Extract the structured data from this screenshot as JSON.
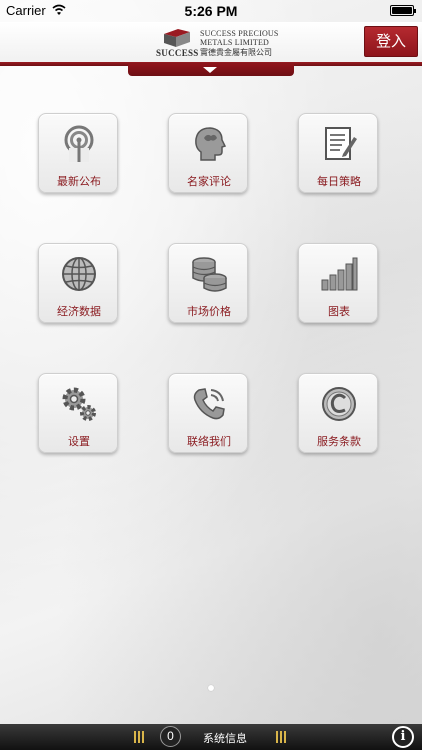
{
  "status_bar": {
    "carrier": "Carrier",
    "time": "5:26 PM"
  },
  "header": {
    "logo": {
      "brand": "SUCCESS",
      "line1": "SUCCESS PRECIOUS",
      "line2": "METALS LIMITED",
      "line3": "實德貴金屬有限公司"
    },
    "login_label": "登入",
    "accent_color": "#8e141b"
  },
  "grid": {
    "items": [
      {
        "label": "最新公布",
        "icon": "broadcast-icon"
      },
      {
        "label": "名家评论",
        "icon": "head-profile-icon"
      },
      {
        "label": "每日策略",
        "icon": "document-pen-icon"
      },
      {
        "label": "经济数据",
        "icon": "globe-icon"
      },
      {
        "label": "市场价格",
        "icon": "coins-stack-icon"
      },
      {
        "label": "图表",
        "icon": "bar-chart-icon"
      },
      {
        "label": "设置",
        "icon": "gears-icon"
      },
      {
        "label": "联络我们",
        "icon": "phone-icon"
      },
      {
        "label": "服务条款",
        "icon": "copyright-icon"
      }
    ]
  },
  "pager": {
    "current_page": 1
  },
  "bottom_bar": {
    "badge_count": "0",
    "system_info_label": "系统信息",
    "info_button_label": "i"
  }
}
